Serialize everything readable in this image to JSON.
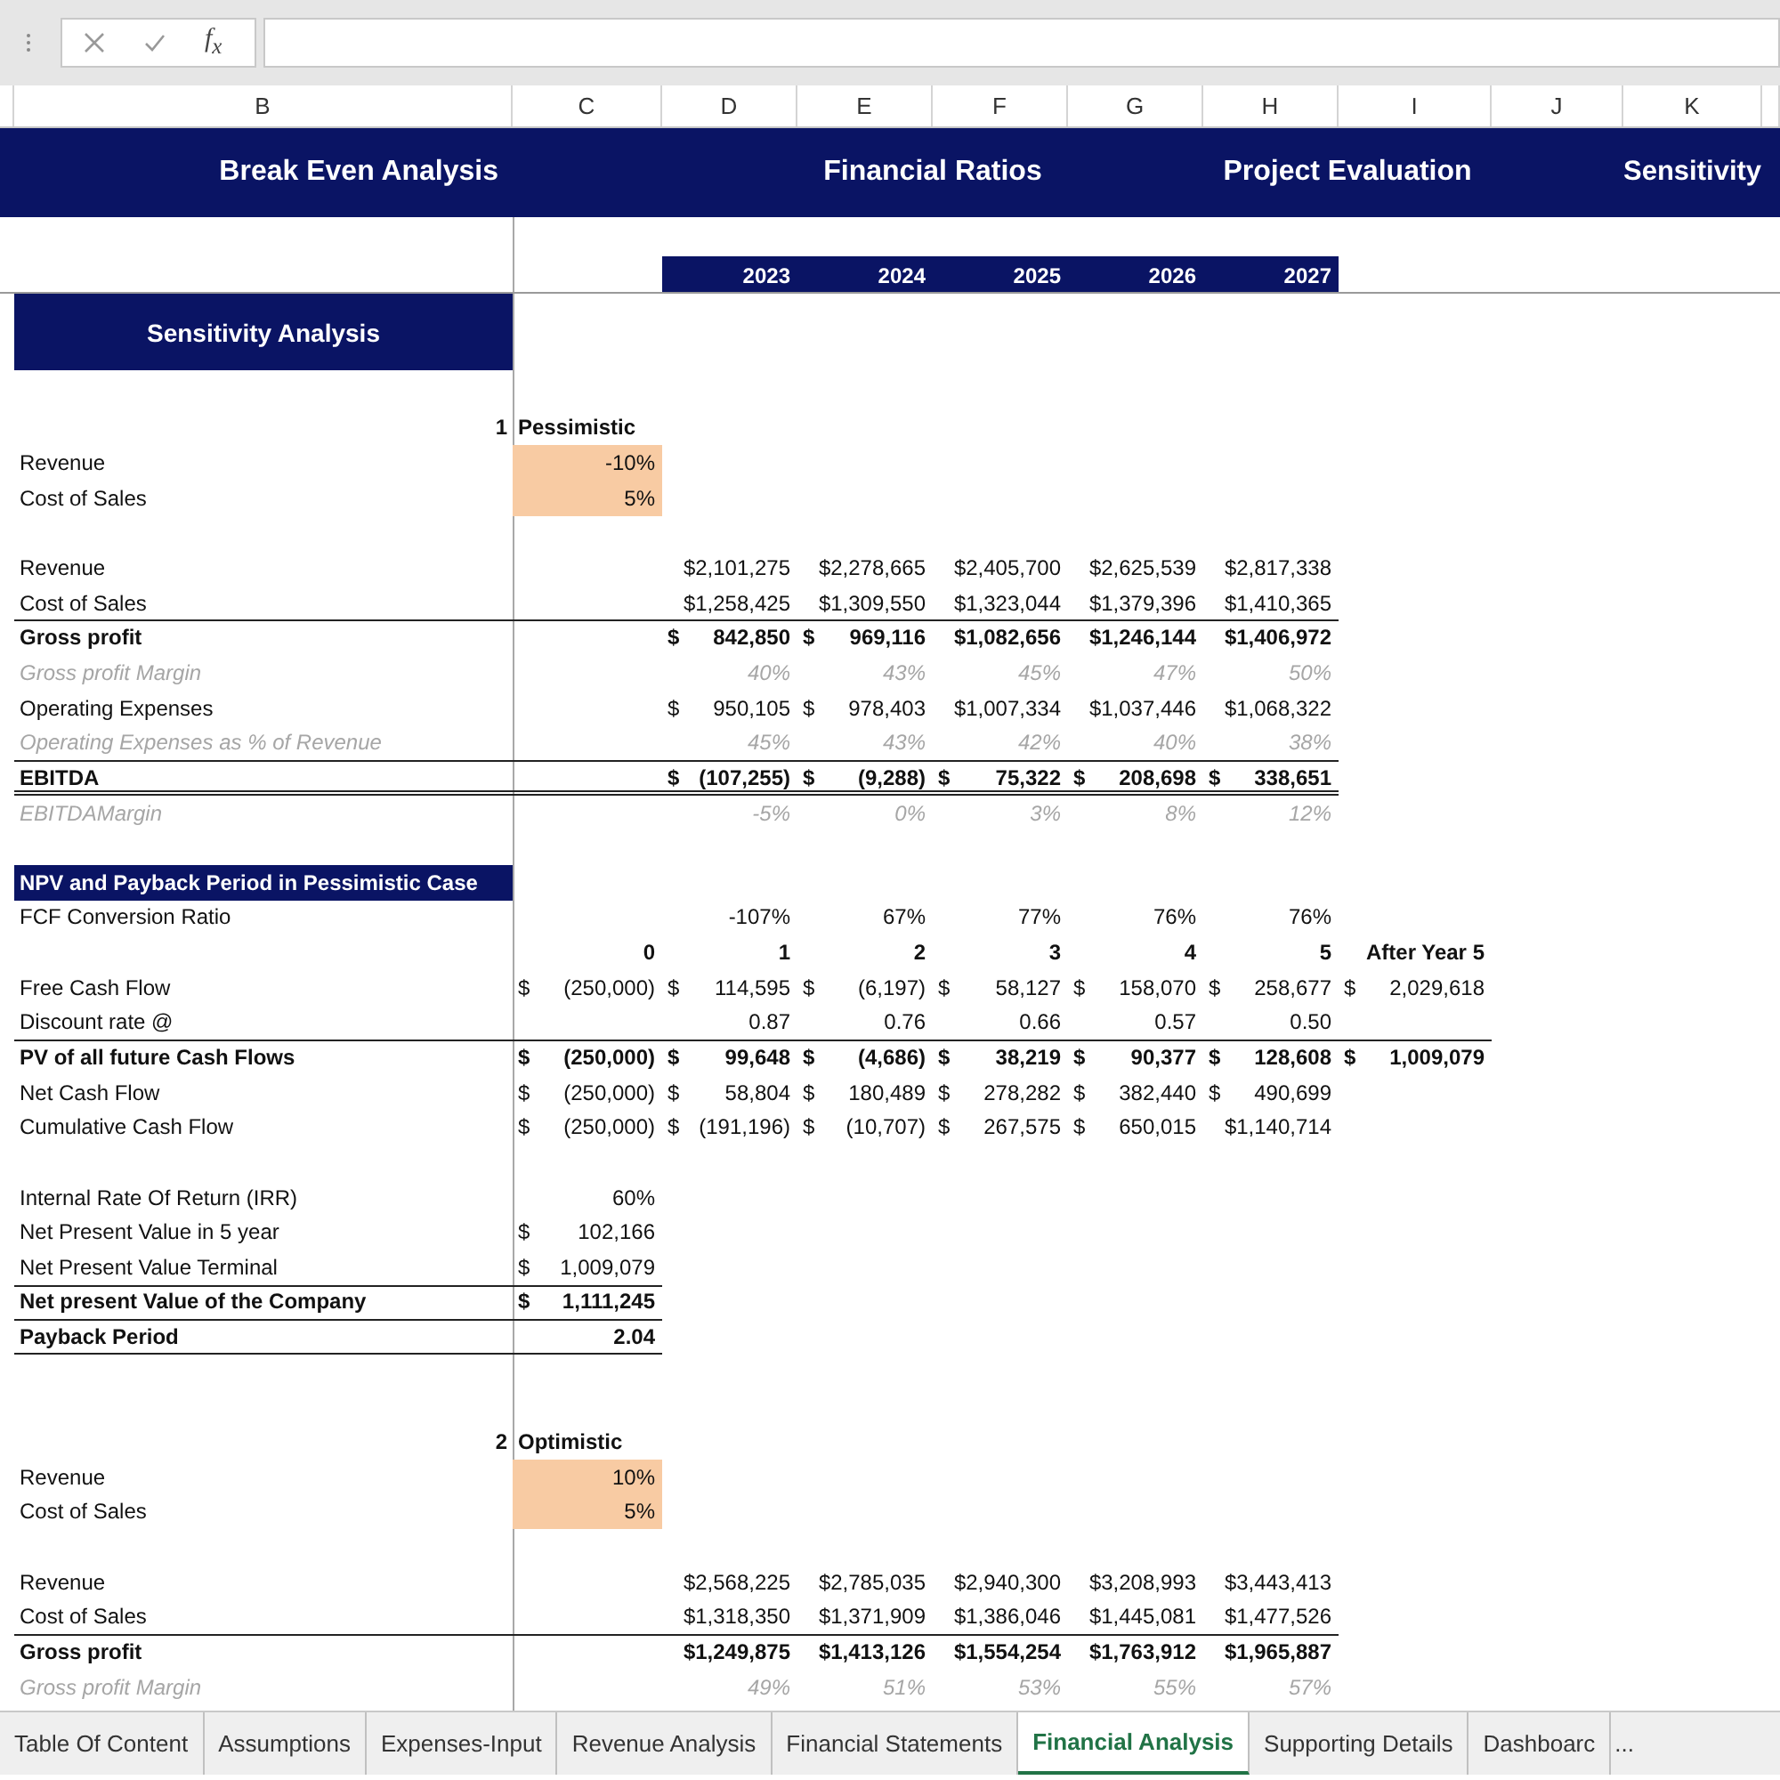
{
  "formula_bar": {
    "insert_function": "f$_{x}$"
  },
  "column_headers": [
    "B",
    "C",
    "D",
    "E",
    "F",
    "G",
    "H",
    "I",
    "J",
    "K"
  ],
  "nav_links": [
    "Break Even Analysis",
    "Financial Ratios",
    "Project Evaluation",
    "Sensitivity"
  ],
  "years": [
    "2023",
    "2024",
    "2025",
    "2026",
    "2027"
  ],
  "section_title": "Sensitivity Analysis",
  "rows": [
    {
      "kind": "scenario",
      "space_before": true,
      "label": "1",
      "cells": {
        "C": "Pessimistic"
      }
    },
    {
      "kind": "input",
      "label": "Revenue",
      "cells": {
        "C": "-10%"
      }
    },
    {
      "kind": "input",
      "label": "Cost of Sales",
      "cells": {
        "C": "5%"
      }
    },
    {
      "kind": "plain",
      "space_before": true,
      "label": "Revenue",
      "cells": {
        "D": "$2,101,275",
        "E": "$2,278,665",
        "F": "$2,405,700",
        "G": "$2,625,539",
        "H": "$2,817,338"
      }
    },
    {
      "kind": "plain",
      "label": "Cost of Sales",
      "cells": {
        "D": "$1,258,425",
        "E": "$1,309,550",
        "F": "$1,323,044",
        "G": "$1,379,396",
        "H": "$1,410,365"
      }
    },
    {
      "kind": "bold",
      "rule_above": true,
      "label": "Gross profit",
      "cells": {
        "D": "$ 842,850",
        "E": "$ 969,116",
        "F": "$1,082,656",
        "G": "$1,246,144",
        "H": "$1,406,972"
      }
    },
    {
      "kind": "muted",
      "label": "Gross profit Margin",
      "cells": {
        "D": "40%",
        "E": "43%",
        "F": "45%",
        "G": "47%",
        "H": "50%"
      }
    },
    {
      "kind": "plain",
      "label": "Operating Expenses",
      "cells": {
        "D": "$ 950,105",
        "E": "$ 978,403",
        "F": "$1,007,334",
        "G": "$1,037,446",
        "H": "$1,068,322"
      }
    },
    {
      "kind": "muted",
      "label": "Operating Expenses as % of Revenue",
      "cells": {
        "D": "45%",
        "E": "43%",
        "F": "42%",
        "G": "40%",
        "H": "38%"
      }
    },
    {
      "kind": "bold",
      "rule_above": true,
      "rule_below": true,
      "double_below": true,
      "label": "EBITDA",
      "cells": {
        "D": "$ (107,255)",
        "E": "$ (9,288)",
        "F": "$ 75,322",
        "G": "$ 208,698",
        "H": "$ 338,651"
      }
    },
    {
      "kind": "muted",
      "label": "EBITDAMargin",
      "cells": {
        "D": "-5%",
        "E": "0%",
        "F": "3%",
        "G": "8%",
        "H": "12%"
      }
    },
    {
      "kind": "section",
      "space_before": true,
      "label": "NPV and Payback Period in Pessimistic Case",
      "cells": {}
    },
    {
      "kind": "plain",
      "label": "FCF Conversion Ratio",
      "cells": {
        "D": "-107%",
        "E": "67%",
        "F": "77%",
        "G": "76%",
        "H": "76%"
      }
    },
    {
      "kind": "header",
      "cells": {
        "C": "0",
        "D": "1",
        "E": "2",
        "F": "3",
        "G": "4",
        "H": "5",
        "I": "After Year 5"
      }
    },
    {
      "kind": "plain",
      "label": "Free Cash Flow",
      "cells": {
        "C": "$ (250,000)",
        "D": "$ 114,595",
        "E": "$ (6,197)",
        "F": "$ 58,127",
        "G": "$ 158,070",
        "H": "$ 258,677",
        "I": "$ 2,029,618"
      }
    },
    {
      "kind": "plain",
      "label": "Discount rate @",
      "cells": {
        "D": "0.87",
        "E": "0.76",
        "F": "0.66",
        "G": "0.57",
        "H": "0.50"
      }
    },
    {
      "kind": "bold",
      "rule_above": true,
      "label": "PV of all future Cash Flows",
      "cells": {
        "C": "$ (250,000)",
        "D": "$ 99,648",
        "E": "$ (4,686)",
        "F": "$ 38,219",
        "G": "$ 90,377",
        "H": "$ 128,608",
        "I": "$ 1,009,079"
      }
    },
    {
      "kind": "plain",
      "label": "Net Cash Flow",
      "cells": {
        "C": "$ (250,000)",
        "D": "$ 58,804",
        "E": "$ 180,489",
        "F": "$ 278,282",
        "G": "$ 382,440",
        "H": "$ 490,699"
      }
    },
    {
      "kind": "plain",
      "label": "Cumulative Cash Flow",
      "cells": {
        "C": "$ (250,000)",
        "D": "$ (191,196)",
        "E": "$ (10,707)",
        "F": "$ 267,575",
        "G": "$ 650,015",
        "H": "$1,140,714"
      }
    },
    {
      "kind": "plain",
      "space_before": true,
      "label": "Internal Rate Of Return (IRR)",
      "cells": {
        "C": "60%"
      }
    },
    {
      "kind": "plain",
      "label": "Net Present Value in 5 year",
      "cells": {
        "C": "$ 102,166"
      }
    },
    {
      "kind": "plain",
      "label": "Net Present Value Terminal",
      "cells": {
        "C": "$ 1,009,079"
      }
    },
    {
      "kind": "bold",
      "rule_above": true,
      "label": "Net present Value of the Company",
      "cells": {
        "C": "$ 1,111,245"
      }
    },
    {
      "kind": "bold",
      "rule_above": true,
      "rule_below": true,
      "space_after": true,
      "label": "Payback Period",
      "cells": {
        "C": "2.04"
      }
    },
    {
      "kind": "scenario",
      "space_before": true,
      "label": "2",
      "cells": {
        "C": "Optimistic"
      }
    },
    {
      "kind": "input",
      "label": "Revenue",
      "cells": {
        "C": "10%"
      }
    },
    {
      "kind": "input",
      "label": "Cost of Sales",
      "cells": {
        "C": "5%"
      }
    },
    {
      "kind": "plain",
      "space_before": true,
      "label": "Revenue",
      "cells": {
        "D": "$2,568,225",
        "E": "$2,785,035",
        "F": "$2,940,300",
        "G": "$3,208,993",
        "H": "$3,443,413"
      }
    },
    {
      "kind": "plain",
      "label": "Cost of Sales",
      "cells": {
        "D": "$1,318,350",
        "E": "$1,371,909",
        "F": "$1,386,046",
        "G": "$1,445,081",
        "H": "$1,477,526"
      }
    },
    {
      "kind": "bold",
      "rule_above": true,
      "label": "Gross profit",
      "cells": {
        "D": "$1,249,875",
        "E": "$1,413,126",
        "F": "$1,554,254",
        "G": "$1,763,912",
        "H": "$1,965,887"
      }
    },
    {
      "kind": "muted",
      "label": "Gross profit Margin",
      "cells": {
        "D": "49%",
        "E": "51%",
        "F": "53%",
        "G": "55%",
        "H": "57%"
      }
    }
  ],
  "sheet_tabs": [
    {
      "label": "Table Of Content",
      "selected": false
    },
    {
      "label": "Assumptions",
      "selected": false
    },
    {
      "label": "Expenses-Input",
      "selected": false
    },
    {
      "label": "Revenue Analysis",
      "selected": false
    },
    {
      "label": "Financial Statements",
      "selected": false
    },
    {
      "label": "Financial Analysis",
      "selected": true
    },
    {
      "label": "Supporting Details",
      "selected": false
    },
    {
      "label": "Dashboarc",
      "selected": false
    }
  ],
  "tabs_more": "..."
}
